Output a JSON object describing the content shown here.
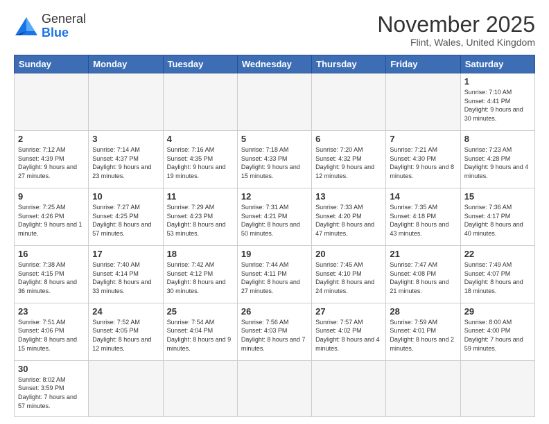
{
  "header": {
    "logo_line1": "General",
    "logo_line2": "Blue",
    "title": "November 2025",
    "subtitle": "Flint, Wales, United Kingdom"
  },
  "weekdays": [
    "Sunday",
    "Monday",
    "Tuesday",
    "Wednesday",
    "Thursday",
    "Friday",
    "Saturday"
  ],
  "weeks": [
    [
      {
        "day": "",
        "info": ""
      },
      {
        "day": "",
        "info": ""
      },
      {
        "day": "",
        "info": ""
      },
      {
        "day": "",
        "info": ""
      },
      {
        "day": "",
        "info": ""
      },
      {
        "day": "",
        "info": ""
      },
      {
        "day": "1",
        "info": "Sunrise: 7:10 AM\nSunset: 4:41 PM\nDaylight: 9 hours\nand 30 minutes."
      }
    ],
    [
      {
        "day": "2",
        "info": "Sunrise: 7:12 AM\nSunset: 4:39 PM\nDaylight: 9 hours\nand 27 minutes."
      },
      {
        "day": "3",
        "info": "Sunrise: 7:14 AM\nSunset: 4:37 PM\nDaylight: 9 hours\nand 23 minutes."
      },
      {
        "day": "4",
        "info": "Sunrise: 7:16 AM\nSunset: 4:35 PM\nDaylight: 9 hours\nand 19 minutes."
      },
      {
        "day": "5",
        "info": "Sunrise: 7:18 AM\nSunset: 4:33 PM\nDaylight: 9 hours\nand 15 minutes."
      },
      {
        "day": "6",
        "info": "Sunrise: 7:20 AM\nSunset: 4:32 PM\nDaylight: 9 hours\nand 12 minutes."
      },
      {
        "day": "7",
        "info": "Sunrise: 7:21 AM\nSunset: 4:30 PM\nDaylight: 9 hours\nand 8 minutes."
      },
      {
        "day": "8",
        "info": "Sunrise: 7:23 AM\nSunset: 4:28 PM\nDaylight: 9 hours\nand 4 minutes."
      }
    ],
    [
      {
        "day": "9",
        "info": "Sunrise: 7:25 AM\nSunset: 4:26 PM\nDaylight: 9 hours\nand 1 minute."
      },
      {
        "day": "10",
        "info": "Sunrise: 7:27 AM\nSunset: 4:25 PM\nDaylight: 8 hours\nand 57 minutes."
      },
      {
        "day": "11",
        "info": "Sunrise: 7:29 AM\nSunset: 4:23 PM\nDaylight: 8 hours\nand 53 minutes."
      },
      {
        "day": "12",
        "info": "Sunrise: 7:31 AM\nSunset: 4:21 PM\nDaylight: 8 hours\nand 50 minutes."
      },
      {
        "day": "13",
        "info": "Sunrise: 7:33 AM\nSunset: 4:20 PM\nDaylight: 8 hours\nand 47 minutes."
      },
      {
        "day": "14",
        "info": "Sunrise: 7:35 AM\nSunset: 4:18 PM\nDaylight: 8 hours\nand 43 minutes."
      },
      {
        "day": "15",
        "info": "Sunrise: 7:36 AM\nSunset: 4:17 PM\nDaylight: 8 hours\nand 40 minutes."
      }
    ],
    [
      {
        "day": "16",
        "info": "Sunrise: 7:38 AM\nSunset: 4:15 PM\nDaylight: 8 hours\nand 36 minutes."
      },
      {
        "day": "17",
        "info": "Sunrise: 7:40 AM\nSunset: 4:14 PM\nDaylight: 8 hours\nand 33 minutes."
      },
      {
        "day": "18",
        "info": "Sunrise: 7:42 AM\nSunset: 4:12 PM\nDaylight: 8 hours\nand 30 minutes."
      },
      {
        "day": "19",
        "info": "Sunrise: 7:44 AM\nSunset: 4:11 PM\nDaylight: 8 hours\nand 27 minutes."
      },
      {
        "day": "20",
        "info": "Sunrise: 7:45 AM\nSunset: 4:10 PM\nDaylight: 8 hours\nand 24 minutes."
      },
      {
        "day": "21",
        "info": "Sunrise: 7:47 AM\nSunset: 4:08 PM\nDaylight: 8 hours\nand 21 minutes."
      },
      {
        "day": "22",
        "info": "Sunrise: 7:49 AM\nSunset: 4:07 PM\nDaylight: 8 hours\nand 18 minutes."
      }
    ],
    [
      {
        "day": "23",
        "info": "Sunrise: 7:51 AM\nSunset: 4:06 PM\nDaylight: 8 hours\nand 15 minutes."
      },
      {
        "day": "24",
        "info": "Sunrise: 7:52 AM\nSunset: 4:05 PM\nDaylight: 8 hours\nand 12 minutes."
      },
      {
        "day": "25",
        "info": "Sunrise: 7:54 AM\nSunset: 4:04 PM\nDaylight: 8 hours\nand 9 minutes."
      },
      {
        "day": "26",
        "info": "Sunrise: 7:56 AM\nSunset: 4:03 PM\nDaylight: 8 hours\nand 7 minutes."
      },
      {
        "day": "27",
        "info": "Sunrise: 7:57 AM\nSunset: 4:02 PM\nDaylight: 8 hours\nand 4 minutes."
      },
      {
        "day": "28",
        "info": "Sunrise: 7:59 AM\nSunset: 4:01 PM\nDaylight: 8 hours\nand 2 minutes."
      },
      {
        "day": "29",
        "info": "Sunrise: 8:00 AM\nSunset: 4:00 PM\nDaylight: 7 hours\nand 59 minutes."
      }
    ],
    [
      {
        "day": "30",
        "info": "Sunrise: 8:02 AM\nSunset: 3:59 PM\nDaylight: 7 hours\nand 57 minutes."
      },
      {
        "day": "",
        "info": ""
      },
      {
        "day": "",
        "info": ""
      },
      {
        "day": "",
        "info": ""
      },
      {
        "day": "",
        "info": ""
      },
      {
        "day": "",
        "info": ""
      },
      {
        "day": "",
        "info": ""
      }
    ]
  ]
}
